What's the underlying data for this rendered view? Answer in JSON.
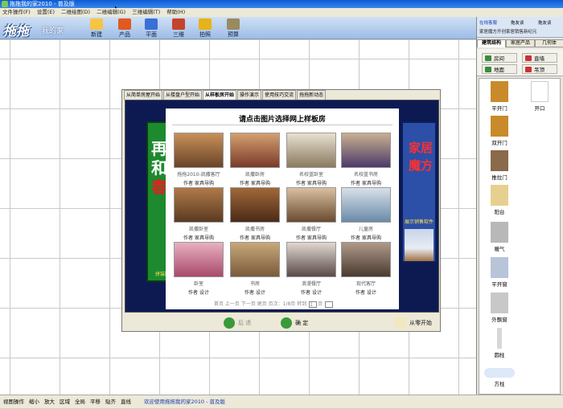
{
  "window": {
    "title": "拖拖我的家2010 - 普及版"
  },
  "menu": [
    "文件操作(F)",
    "设置(E)",
    "二维绘图(D)",
    "二维编辑(G)",
    "三维编辑(T)",
    "帮助(H)"
  ],
  "logo": {
    "brand": "拖拖",
    "subtitle": "我的家"
  },
  "toolbar": [
    {
      "label": "新建",
      "icon": "new-icon",
      "color": "#f5c542"
    },
    {
      "label": "产品",
      "icon": "product-icon",
      "color": "#e05a20"
    },
    {
      "label": "平面",
      "icon": "floorplan-icon",
      "color": "#3a6fd8"
    },
    {
      "label": "三维",
      "icon": "house-icon",
      "color": "#c4442a"
    },
    {
      "label": "拍照",
      "icon": "camera-icon",
      "color": "#e8b218"
    },
    {
      "label": "预算",
      "icon": "budget-icon",
      "color": "#9a8a60"
    }
  ],
  "user": {
    "status": "在线客服",
    "service1": "拖友谈",
    "service2": "拖友谈",
    "message": "家居魔方开创家居销售新纪元"
  },
  "right_tabs": [
    "建筑结构",
    "家居产品",
    "几何体"
  ],
  "right_buttons": [
    {
      "label": "房间",
      "color": "#3a8a3a"
    },
    {
      "label": "直墙",
      "color": "#c83232"
    },
    {
      "label": "地面",
      "color": "#3a8a3a"
    },
    {
      "label": "吊顶",
      "color": "#c83232"
    }
  ],
  "components": [
    {
      "label": "平开门",
      "color": "#c98a2a"
    },
    {
      "label": "开口",
      "color": "#ffffff"
    },
    {
      "label": "双开门",
      "color": "#c98a2a"
    },
    {
      "label": "推拉门",
      "color": "#8a6a4a"
    },
    {
      "label": "阳台",
      "color": "#e6d090"
    },
    {
      "label": "暖气",
      "color": "#b8b8b8"
    },
    {
      "label": "平开窗",
      "color": "#b8c4d8"
    },
    {
      "label": "外飘窗",
      "color": "#c8c8c8"
    },
    {
      "label": "圆柱",
      "color": "#d8d8d8"
    },
    {
      "label": "方柱",
      "color": "#d8d8d8"
    }
  ],
  "dialog": {
    "tabs": [
      "从简单房屋开始",
      "从楼盘户型开始",
      "从样板房开始",
      "操作演示",
      "使用技巧交流",
      "拖拖新动态"
    ],
    "heading": "请点击图片选择网上样板房",
    "banner_left": {
      "chars": [
        "再",
        "添",
        "和",
        "暖",
        "春",
        "色"
      ],
      "footer": "拼装防盗门"
    },
    "banner_right": {
      "chars": [
        "家",
        "居",
        "魔",
        "方"
      ],
      "footer": "展示销售软件"
    },
    "rooms": [
      {
        "name": "拖拖2010-凯撒客厅",
        "author": "作者 家具导购",
        "c1": "#6a4428",
        "c2": "#c89058"
      },
      {
        "name": "凯撒卧房",
        "author": "作者 家具导购",
        "c1": "#7a3a2a",
        "c2": "#d4a070"
      },
      {
        "name": "名校蓝卧室",
        "author": "作者 家具导购",
        "c1": "#8a7a60",
        "c2": "#e8e0d0"
      },
      {
        "name": "名校蓝书房",
        "author": "作者 家具导购",
        "c1": "#4a3a6a",
        "c2": "#c8b090"
      },
      {
        "name": "凯撒卧室",
        "author": "作者 家具导购",
        "c1": "#5a3a22",
        "c2": "#b07a48"
      },
      {
        "name": "凯撒书房",
        "author": "作者 家具导购",
        "c1": "#4a2a18",
        "c2": "#a06838"
      },
      {
        "name": "凯撒餐厅",
        "author": "作者 家具导购",
        "c1": "#6a4a30",
        "c2": "#d8c0a0"
      },
      {
        "name": "儿童房",
        "author": "作者 家具导购",
        "c1": "#6a8aa8",
        "c2": "#d8e0e8"
      },
      {
        "name": "卧室",
        "author": "作者 设计",
        "c1": "#a84a6a",
        "c2": "#e8b0c0"
      },
      {
        "name": "书房",
        "author": "作者 设计",
        "c1": "#7a5a3a",
        "c2": "#c8a878"
      },
      {
        "name": "浪漫餐厅",
        "author": "作者 设计",
        "c1": "#5a4a48",
        "c2": "#e0d8d0"
      },
      {
        "name": "现代客厅",
        "author": "作者 设计",
        "c1": "#4a3a30",
        "c2": "#b0988a"
      }
    ],
    "pager": {
      "text": "首页 上一页 下一页 尾页 页次：1/8页 转到",
      "page_input": "1",
      "go": "页"
    },
    "buttons": {
      "back": "后 退",
      "ok": "确 定",
      "start": "从零开始"
    }
  },
  "statusbar": {
    "items": [
      "视图操作",
      "缩小",
      "放大",
      "区域",
      "全局",
      "平移",
      "贴齐",
      "直线"
    ],
    "welcome": "欢迎使用拖拖我的家2010 - 普及版"
  }
}
